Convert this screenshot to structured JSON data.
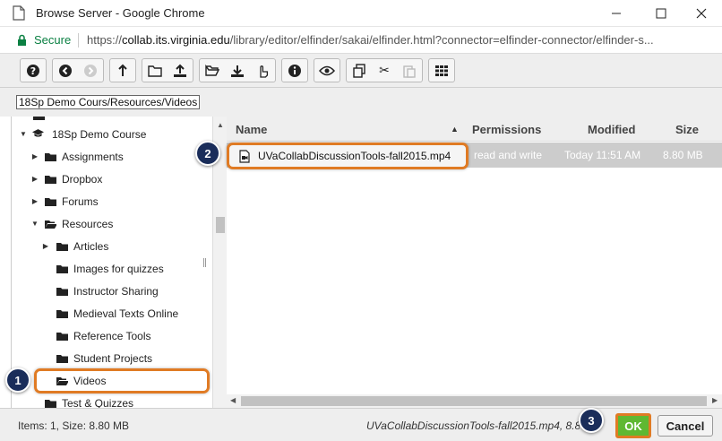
{
  "window": {
    "title": "Browse Server - Google Chrome",
    "minimize": "minimize",
    "maximize": "maximize",
    "close": "close"
  },
  "address_bar": {
    "security_label": "Secure",
    "url_scheme": "https://",
    "url_host": "collab.its.virginia.edu",
    "url_path": "/library/editor/elfinder/sakai/elfinder.html?connector=elfinder-connector/elfinder-s..."
  },
  "toolbar": {
    "groups": [
      [
        "help-icon"
      ],
      [
        "back-icon",
        "forward-icon"
      ],
      [
        "up-icon"
      ],
      [
        "new-folder-icon",
        "upload-icon"
      ],
      [
        "open-icon",
        "download-icon",
        "select-icon"
      ],
      [
        "info-icon"
      ],
      [
        "preview-icon"
      ],
      [
        "copy-icon",
        "cut-icon",
        "paste-icon"
      ],
      [
        "view-icon"
      ]
    ]
  },
  "path": "18Sp Demo Cours/Resources/Videos",
  "tree": {
    "items": [
      {
        "label": "18Sp Demo Course",
        "icon": "course-icon",
        "expanded": true
      },
      {
        "label": "Assignments",
        "icon": "folder-icon"
      },
      {
        "label": "Dropbox",
        "icon": "folder-icon"
      },
      {
        "label": "Forums",
        "icon": "folder-icon"
      },
      {
        "label": "Resources",
        "icon": "folder-open-icon",
        "expanded": true
      },
      {
        "label": "Articles",
        "icon": "folder-icon"
      },
      {
        "label": "Images for quizzes",
        "icon": "folder-icon"
      },
      {
        "label": "Instructor Sharing",
        "icon": "folder-icon"
      },
      {
        "label": "Medieval Texts Online",
        "icon": "folder-icon"
      },
      {
        "label": "Reference Tools",
        "icon": "folder-icon"
      },
      {
        "label": "Student Projects",
        "icon": "folder-icon"
      },
      {
        "label": "Videos",
        "icon": "folder-open-icon",
        "selected": true
      },
      {
        "label": "Test & Quizzes",
        "icon": "folder-icon"
      }
    ]
  },
  "files": {
    "columns": [
      "Name",
      "Permissions",
      "Modified",
      "Size"
    ],
    "sort_indicator": "▲",
    "rows": [
      {
        "name": "UVaCollabDiscussionTools-fall2015.mp4",
        "permissions": "read and write",
        "modified": "Today 11:51 AM",
        "size": "8.80 MB"
      }
    ]
  },
  "status": {
    "left": "Items: 1, Size: 8.80 MB",
    "right": "UVaCollabDiscussionTools-fall2015.mp4, 8.80 MB"
  },
  "buttons": {
    "ok": "OK",
    "cancel": "Cancel"
  },
  "callouts": [
    "1",
    "2",
    "3"
  ],
  "colors": {
    "highlight": "#e07b24",
    "badge": "#1a2d5a",
    "ok_button": "#5fb832",
    "secure": "#0b8043"
  }
}
